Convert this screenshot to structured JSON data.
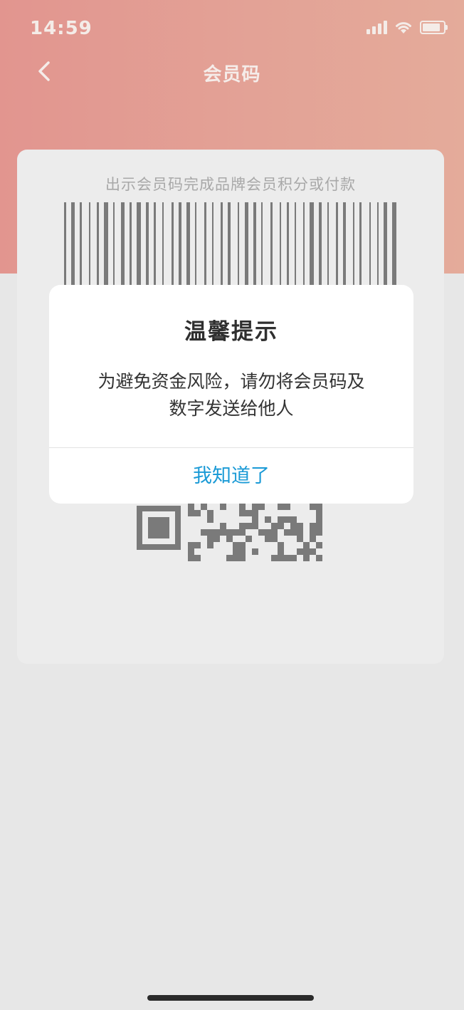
{
  "status_bar": {
    "time": "14:59"
  },
  "nav": {
    "title": "会员码",
    "back_icon": "chevron-left-icon"
  },
  "card": {
    "hint": "出示会员码完成品牌会员积分或付款"
  },
  "dialog": {
    "title": "温馨提示",
    "message_line1": "为避免资金风险，请勿将会员码及",
    "message_line2": "数字发送给他人",
    "confirm_label": "我知道了"
  },
  "colors": {
    "header_gradient_start": "#e2958f",
    "header_gradient_end": "#e4ab9a",
    "page_background": "#e7e7e7",
    "accent_button": "#1a9ad6",
    "code_gray": "#7a7a7a"
  }
}
